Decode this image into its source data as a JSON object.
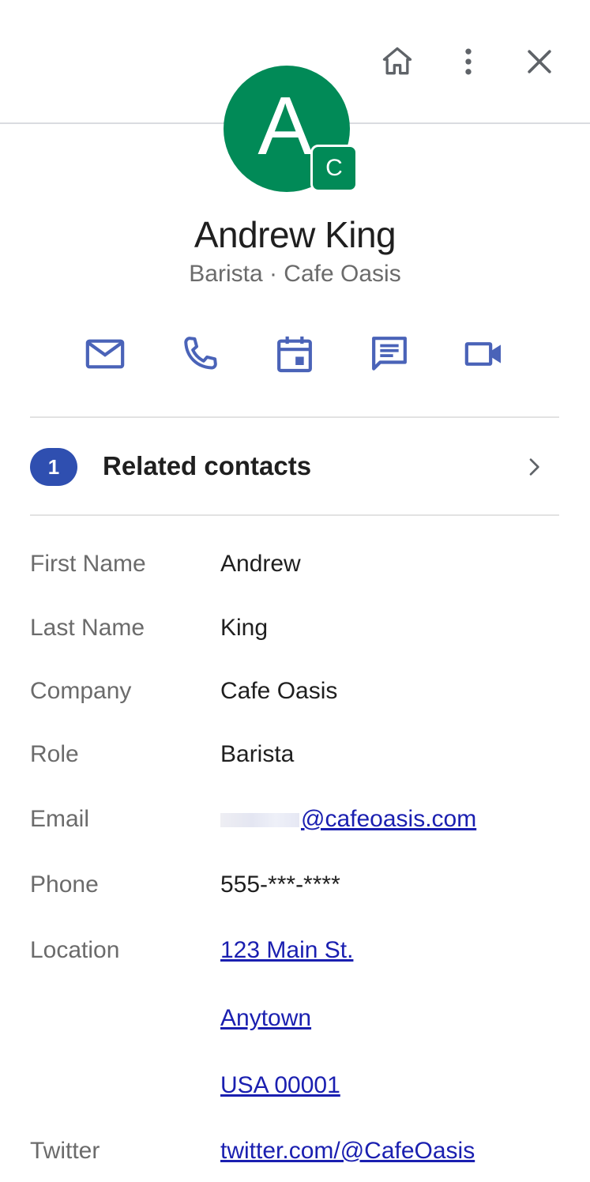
{
  "header": {
    "icons": [
      "home-icon",
      "more-vert-icon",
      "close-icon"
    ]
  },
  "contact": {
    "avatar_letter": "A",
    "badge_letter": "C",
    "avatar_color": "#018a57",
    "name": "Andrew King",
    "subtitle": "Barista · Cafe Oasis"
  },
  "actions": [
    "email-icon",
    "phone-icon",
    "calendar-icon",
    "chat-icon",
    "video-icon"
  ],
  "accent_color": "#4a63b8",
  "related": {
    "count": "1",
    "label": "Related contacts"
  },
  "details": {
    "first_name": {
      "label": "First Name",
      "value": "Andrew"
    },
    "last_name": {
      "label": "Last Name",
      "value": "King"
    },
    "company": {
      "label": "Company",
      "value": "Cafe Oasis"
    },
    "role": {
      "label": "Role",
      "value": "Barista"
    },
    "email": {
      "label": "Email",
      "value": "@cafeoasis.com"
    },
    "phone": {
      "label": "Phone",
      "value": "555-***-****"
    },
    "location": {
      "label": "Location",
      "line1": "123 Main St.",
      "line2": "Anytown",
      "line3": "USA 00001"
    },
    "twitter": {
      "label": "Twitter",
      "value": "twitter.com/@CafeOasis"
    }
  }
}
